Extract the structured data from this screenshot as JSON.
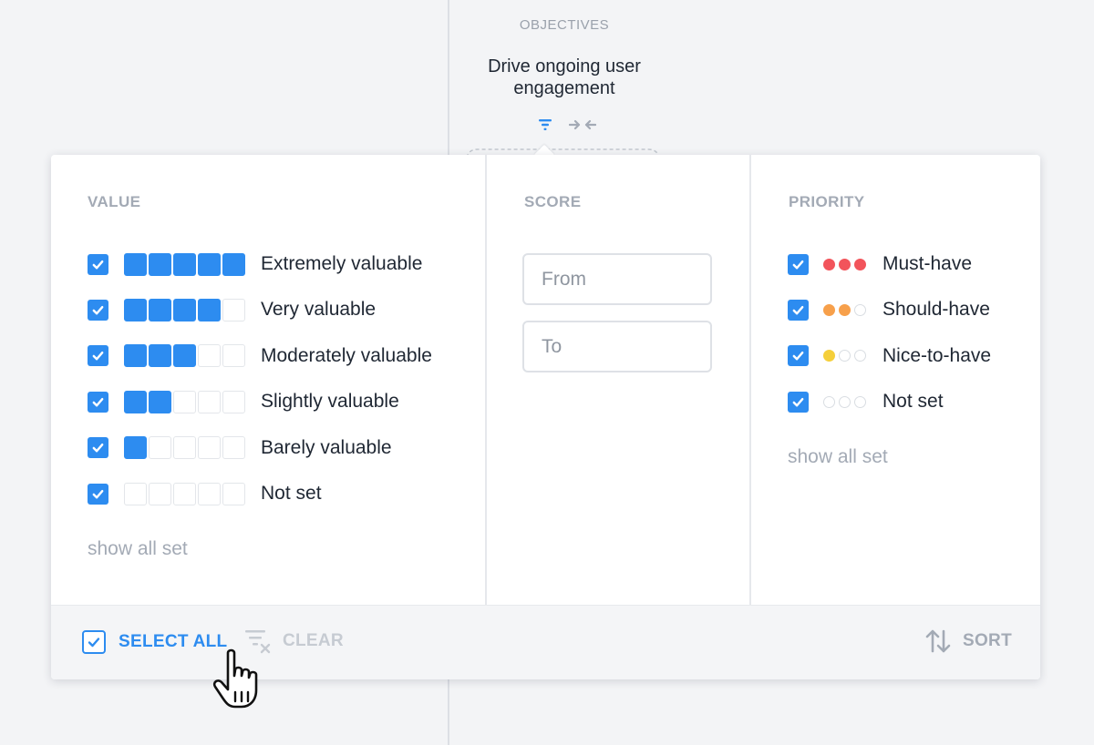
{
  "objectives": {
    "label": "OBJECTIVES",
    "title": "Drive ongoing user engagement",
    "icons": [
      "filter-icon",
      "collapse-arrows-icon"
    ]
  },
  "value": {
    "header": "VALUE",
    "items": [
      {
        "label": "Extremely valuable",
        "level": 5,
        "checked": true
      },
      {
        "label": "Very valuable",
        "level": 4,
        "checked": true
      },
      {
        "label": "Moderately valuable",
        "level": 3,
        "checked": true
      },
      {
        "label": "Slightly valuable",
        "level": 2,
        "checked": true
      },
      {
        "label": "Barely valuable",
        "level": 1,
        "checked": true
      },
      {
        "label": "Not set",
        "level": 0,
        "checked": true
      }
    ],
    "max_level": 5,
    "show_all": "show all set"
  },
  "score": {
    "header": "SCORE",
    "from_placeholder": "From",
    "to_placeholder": "To"
  },
  "priority": {
    "header": "PRIORITY",
    "items": [
      {
        "label": "Must-have",
        "level": 3,
        "color": "#f2545b",
        "checked": true
      },
      {
        "label": "Should-have",
        "level": 2,
        "color": "#f7a04b",
        "checked": true
      },
      {
        "label": "Nice-to-have",
        "level": 1,
        "color": "#f5cf3a",
        "checked": true
      },
      {
        "label": "Not set",
        "level": 0,
        "color": "#d9dde2",
        "checked": true
      }
    ],
    "max_level": 3,
    "show_all": "show all set"
  },
  "footer": {
    "select_all": "SELECT ALL",
    "clear": "CLEAR",
    "sort": "SORT"
  },
  "colors": {
    "accent": "#2d8cf0",
    "muted": "#a3aab5",
    "disabled": "#c6cbd2"
  }
}
